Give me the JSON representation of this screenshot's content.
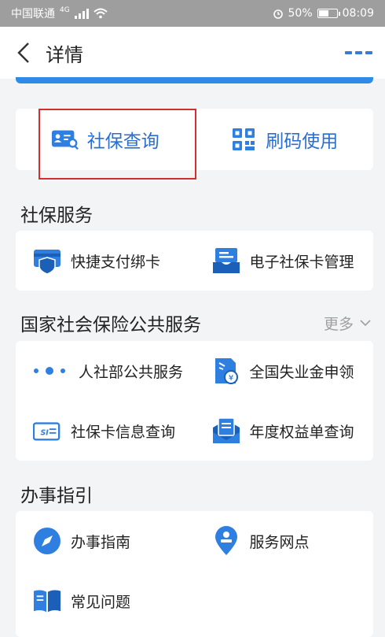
{
  "statusbar": {
    "carrier": "中国联通",
    "network": "4G",
    "battery": "50%",
    "time": "08:09"
  },
  "navbar": {
    "title": "详情"
  },
  "quick_actions": [
    {
      "label": "社保查询",
      "icon": "id-card-search-icon"
    },
    {
      "label": "刷码使用",
      "icon": "qr-code-icon"
    }
  ],
  "sections": {
    "social_security": {
      "title": "社保服务",
      "items": [
        {
          "label": "快捷支付绑卡",
          "icon": "card-shield-icon"
        },
        {
          "label": "电子社保卡管理",
          "icon": "card-manage-icon"
        }
      ]
    },
    "national": {
      "title": "国家社会保险公共服务",
      "more": "更多",
      "items": [
        {
          "label": "人社部公共服务",
          "icon": "dots-icon"
        },
        {
          "label": "全国失业金申领",
          "icon": "yuan-document-icon"
        },
        {
          "label": "社保卡信息查询",
          "icon": "si-card-icon"
        },
        {
          "label": "年度权益单查询",
          "icon": "envelope-document-icon"
        }
      ]
    },
    "guide": {
      "title": "办事指引",
      "items": [
        {
          "label": "办事指南",
          "icon": "compass-icon"
        },
        {
          "label": "服务网点",
          "icon": "location-pin-icon"
        },
        {
          "label": "常见问题",
          "icon": "book-icon"
        }
      ]
    }
  },
  "colors": {
    "accent": "#2a6fd0",
    "icon_blue": "#2f7fe0",
    "highlight": "#d32f2f"
  }
}
